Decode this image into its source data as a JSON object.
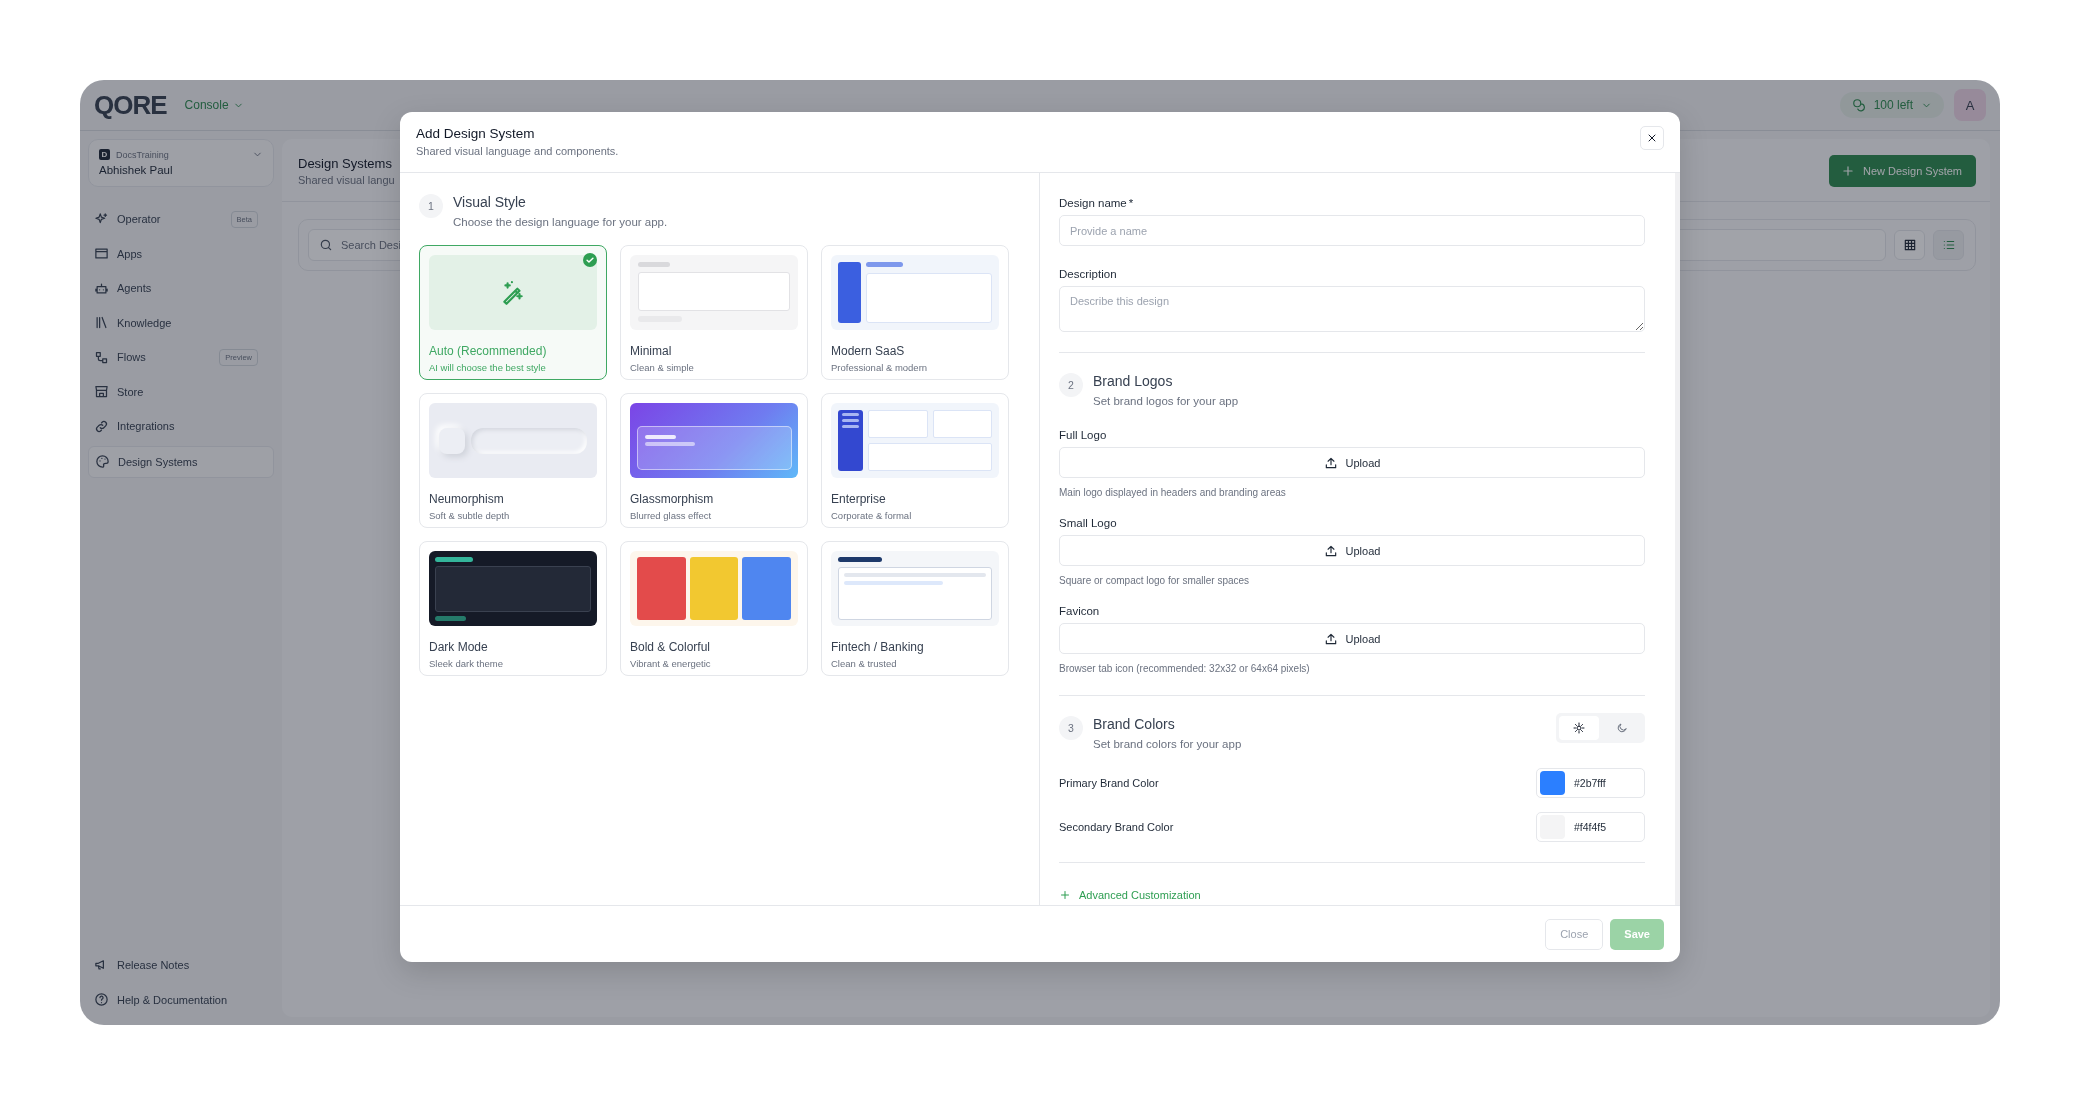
{
  "app": {
    "logo": "QORE",
    "product_menu": "Console",
    "credits": "100 left",
    "avatar": "A"
  },
  "sidebar": {
    "workspace": {
      "badge": "D",
      "name": "DocsTraining",
      "user": "Abhishek Paul"
    },
    "items": [
      {
        "label": "Operator",
        "badge": "Beta",
        "selected": false
      },
      {
        "label": "Apps",
        "selected": false
      },
      {
        "label": "Agents",
        "selected": false
      },
      {
        "label": "Knowledge",
        "selected": false
      },
      {
        "label": "Flows",
        "badge": "Preview",
        "selected": false
      },
      {
        "label": "Store",
        "selected": false
      },
      {
        "label": "Integrations",
        "selected": false
      },
      {
        "label": "Design Systems",
        "selected": true
      }
    ],
    "footer_items": [
      {
        "label": "Release Notes"
      },
      {
        "label": "Help & Documentation"
      }
    ]
  },
  "page": {
    "title": "Design Systems",
    "subtitle": "Shared visual langu",
    "new_button": "New Design System",
    "search": {
      "placeholder": "Search Desi"
    },
    "view_toggle": [
      {
        "kind": "grid",
        "selected": false
      },
      {
        "kind": "list",
        "selected": true
      }
    ]
  },
  "modal": {
    "title": "Add Design System",
    "subtitle": "Shared visual language and components.",
    "visual_style": {
      "step": "1",
      "title": "Visual Style",
      "subtitle": "Choose the design language for your app.",
      "styles": [
        {
          "kind": "auto",
          "title": "Auto (Recommended)",
          "subtitle": "AI will choose the best style",
          "selected": true
        },
        {
          "kind": "minimal",
          "title": "Minimal",
          "subtitle": "Clean & simple",
          "selected": false
        },
        {
          "kind": "saas",
          "title": "Modern SaaS",
          "subtitle": "Professional & modern",
          "selected": false
        },
        {
          "kind": "neumorphism",
          "title": "Neumorphism",
          "subtitle": "Soft & subtle depth",
          "selected": false
        },
        {
          "kind": "glass",
          "title": "Glassmorphism",
          "subtitle": "Blurred glass effect",
          "selected": false
        },
        {
          "kind": "enterprise",
          "title": "Enterprise",
          "subtitle": "Corporate & formal",
          "selected": false
        },
        {
          "kind": "dark",
          "title": "Dark Mode",
          "subtitle": "Sleek dark theme",
          "selected": false
        },
        {
          "kind": "bold",
          "title": "Bold & Colorful",
          "subtitle": "Vibrant & energetic",
          "selected": false
        },
        {
          "kind": "fintech",
          "title": "Fintech / Banking",
          "subtitle": "Clean & trusted",
          "selected": false
        }
      ]
    },
    "design_name": {
      "label": "Design name",
      "required_mark": "*",
      "placeholder": "Provide a name"
    },
    "description": {
      "label": "Description",
      "placeholder": "Describe this design"
    },
    "brand_logos": {
      "step": "2",
      "title": "Brand Logos",
      "subtitle": "Set brand logos for your app",
      "uploads": [
        {
          "label": "Full Logo",
          "button": "Upload",
          "hint": "Main logo displayed in headers and branding areas"
        },
        {
          "label": "Small Logo",
          "button": "Upload",
          "hint": "Square or compact logo for smaller spaces"
        },
        {
          "label": "Favicon",
          "button": "Upload",
          "hint": "Browser tab icon (recommended: 32x32 or 64x64 pixels)"
        }
      ]
    },
    "brand_colors": {
      "step": "3",
      "title": "Brand Colors",
      "subtitle": "Set brand colors for your app",
      "theme_toggle": [
        {
          "kind": "light",
          "selected": true
        },
        {
          "kind": "dark",
          "selected": false
        }
      ],
      "colors": [
        {
          "label": "Primary Brand Color",
          "value": "#2b7fff",
          "color": "#2b7fff"
        },
        {
          "label": "Secondary Brand Color",
          "value": "#f4f4f5",
          "color": "#f4f4f5"
        }
      ]
    },
    "advanced": "Advanced Customization",
    "footer": {
      "close": {
        "label": "Close",
        "disabled": true
      },
      "save": {
        "label": "Save",
        "disabled": true
      }
    }
  }
}
